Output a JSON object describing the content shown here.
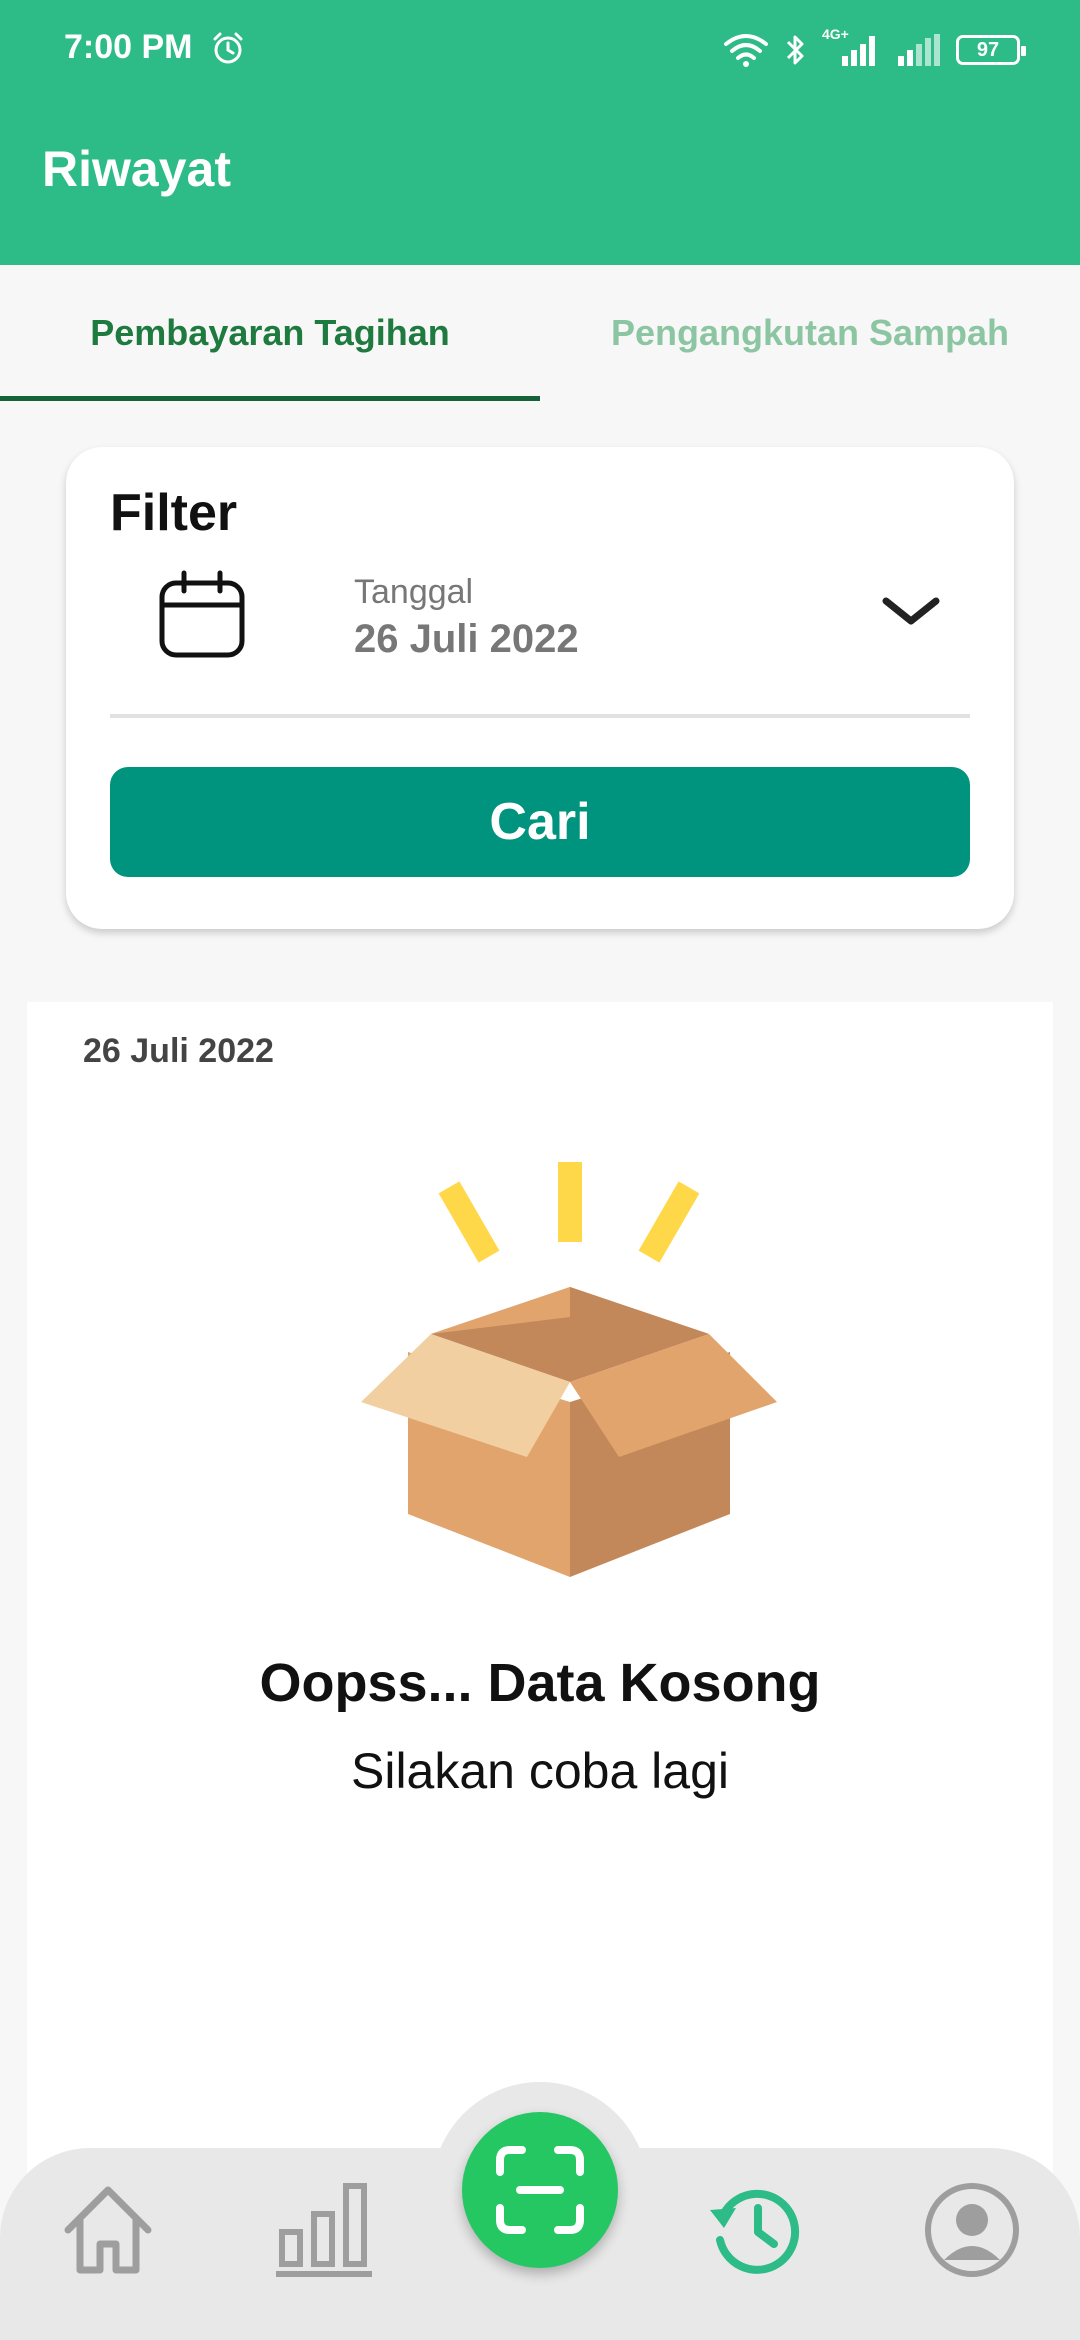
{
  "status_bar": {
    "time": "7:00 PM",
    "network": "4G+",
    "battery": "97"
  },
  "header": {
    "title": "Riwayat"
  },
  "tabs": [
    {
      "label": "Pembayaran Tagihan",
      "active": true
    },
    {
      "label": "Pengangkutan Sampah",
      "active": false
    }
  ],
  "filter": {
    "title": "Filter",
    "date_label": "Tanggal",
    "date_value": "26 Juli 2022",
    "search_button": "Cari"
  },
  "result": {
    "date": "26 Juli 2022",
    "empty_title": "Oopss... Data Kosong",
    "empty_subtitle": "Silakan coba lagi"
  },
  "colors": {
    "header": "#2dbb88",
    "primary_button": "#00937d",
    "fab": "#24c762",
    "active_tab": "#1f7a3f",
    "inactive_tab": "#8cc5a1"
  },
  "nav": {
    "items": [
      "home-icon",
      "stats-icon",
      "scan-icon",
      "history-icon",
      "profile-icon"
    ],
    "active": "history-icon"
  }
}
